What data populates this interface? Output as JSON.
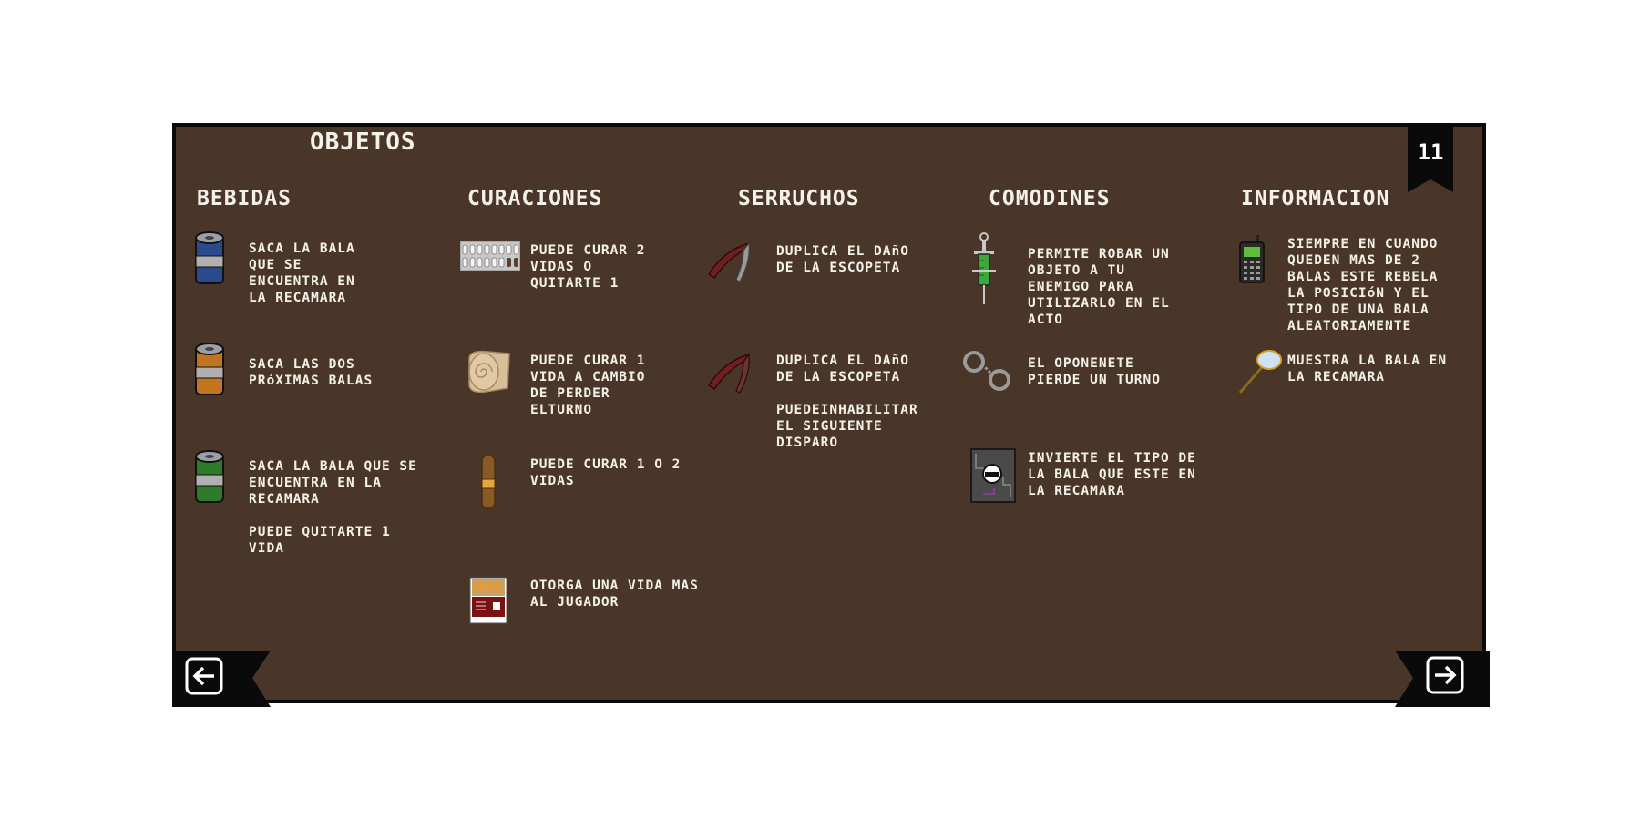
{
  "title": "OBJETOS",
  "page_number": "11",
  "columns": [
    {
      "header": "BEBIDAS",
      "items": [
        {
          "icon": "blue-can-icon",
          "text": "SACA LA BALA\nQUE SE\nENCUENTRA EN\nLA RECAMARA"
        },
        {
          "icon": "orange-can-icon",
          "text": "SACA LAS DOS\nPRóXIMAS BALAS"
        },
        {
          "icon": "green-can-icon",
          "text": "SACA LA BALA QUE SE\nENCUENTRA EN LA\nRECAMARA\n\nPUEDE QUITARTE 1\nVIDA"
        }
      ]
    },
    {
      "header": "CURACIONES",
      "items": [
        {
          "icon": "pill-blister-icon",
          "text": "PUEDE CURAR 2\nVIDAS O\nQUITARTE 1"
        },
        {
          "icon": "bandage-roll-icon",
          "text": "PUEDE CURAR 1\nVIDA A CAMBIO\nDE PERDER\nELTURNO"
        },
        {
          "icon": "cigar-icon",
          "text": "PUEDE CURAR 1 O 2\nVIDAS"
        },
        {
          "icon": "cigarette-pack-icon",
          "text": "OTORGA UNA VIDA MAS\nAL JUGADOR"
        }
      ]
    },
    {
      "header": "SERRUCHOS",
      "items": [
        {
          "icon": "saw-icon",
          "text": "DUPLICA EL DAñO\nDE LA ESCOPETA"
        },
        {
          "icon": "saw-dark-icon",
          "text": "DUPLICA EL DAñO\nDE LA ESCOPETA\n\nPUEDEINHABILITAR\nEL SIGUIENTE\nDISPARO"
        }
      ]
    },
    {
      "header": "COMODINES",
      "items": [
        {
          "icon": "syringe-icon",
          "text": "PERMITE ROBAR UN\nOBJETO A TU\nENEMIGO PARA\nUTILIZARLO EN EL\nACTO"
        },
        {
          "icon": "handcuffs-icon",
          "text": "EL OPONENETE\nPIERDE UN TURNO"
        },
        {
          "icon": "inverter-icon",
          "text": "INVIERTE EL TIPO DE\nLA BALA QUE ESTE EN\nLA RECAMARA"
        }
      ]
    },
    {
      "header": "INFORMACION",
      "items": [
        {
          "icon": "phone-icon",
          "text": "SIEMPRE EN CUANDO\nQUEDEN MAS DE 2\nBALAS ESTE REBELA\nLA POSICIóN Y EL\nTIPO DE UNA BALA\nALEATORIAMENTE"
        },
        {
          "icon": "magnifying-glass-icon",
          "text": "MUESTRA LA BALA EN\nLA RECAMARA"
        }
      ]
    }
  ],
  "nav": {
    "prev": "arrow-left-icon",
    "next": "arrow-right-icon"
  },
  "colors": {
    "background": "#4a3628",
    "text": "#f4f1e8",
    "frame": "#0a0a0a"
  }
}
